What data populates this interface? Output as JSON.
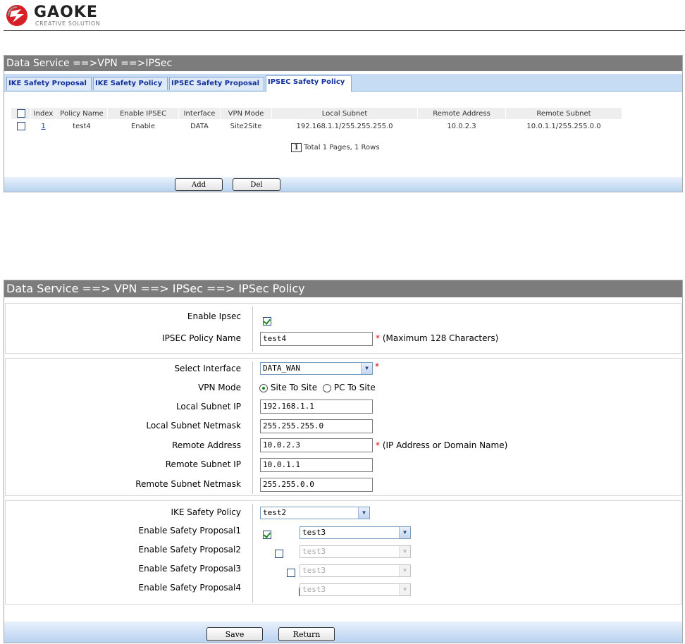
{
  "header": {
    "brand": "GAOKE",
    "tagline": "CREATIVE SOLUTION"
  },
  "list_panel": {
    "title": "Data Service ==>VPN ==>IPSec",
    "tabs": [
      {
        "label": "IKE Safety Proposal",
        "active": false
      },
      {
        "label": "IKE Safety Policy",
        "active": false
      },
      {
        "label": "IPSEC Safety Proposal",
        "active": false
      },
      {
        "label": "IPSEC Safety Policy",
        "active": true
      }
    ],
    "columns": [
      "Index",
      "Policy Name",
      "Enable IPSEC",
      "Interface",
      "VPN Mode",
      "Local Subnet",
      "Remote Address",
      "Remote Subnet"
    ],
    "rows": [
      {
        "index": "1",
        "policy_name": "test4",
        "enable_ipsec": "Enable",
        "interface": "DATA",
        "vpn_mode": "Site2Site",
        "local_subnet": "192.168.1.1/255.255.255.0",
        "remote_address": "10.0.2.3",
        "remote_subnet": "10.0.1.1/255.255.0.0"
      }
    ],
    "pager": {
      "page": "1",
      "summary": "Total 1 Pages, 1 Rows"
    },
    "add_label": "Add",
    "del_label": "Del"
  },
  "form_panel": {
    "title": "Data Service ==> VPN ==> IPSec ==> IPSec Policy",
    "enable_ipsec": {
      "label": "Enable Ipsec",
      "checked": true
    },
    "policy_name": {
      "label": "IPSEC Policy Name",
      "value": "test4",
      "note": "(Maximum 128 Characters)"
    },
    "interface": {
      "label": "Select Interface",
      "value": "DATA_WAN"
    },
    "vpn_mode": {
      "label": "VPN Mode",
      "options": [
        "Site To Site",
        "PC To Site"
      ],
      "selected": "Site To Site"
    },
    "local_subnet_ip": {
      "label": "Local Subnet IP",
      "value": "192.168.1.1"
    },
    "local_subnet_netmask": {
      "label": "Local Subnet Netmask",
      "value": "255.255.255.0"
    },
    "remote_address": {
      "label": "Remote Address",
      "value": "10.0.2.3",
      "note": "(IP Address or Domain Name)"
    },
    "remote_subnet_ip": {
      "label": "Remote Subnet IP",
      "value": "10.0.1.1"
    },
    "remote_subnet_netmask": {
      "label": "Remote Subnet Netmask",
      "value": "255.255.0.0"
    },
    "ike_policy": {
      "label": "IKE Safety Policy",
      "value": "test2"
    },
    "proposals": [
      {
        "label": "Enable Safety Proposal1",
        "checked": true,
        "value": "test3",
        "enabled": true
      },
      {
        "label": "Enable Safety Proposal2",
        "checked": false,
        "value": "test3",
        "enabled": false
      },
      {
        "label": "Enable Safety Proposal3",
        "checked": false,
        "value": "test3",
        "enabled": false
      },
      {
        "label": "Enable Safety Proposal4",
        "checked": false,
        "value": "test3",
        "enabled": false
      }
    ],
    "required_mark": "*",
    "save_label": "Save",
    "return_label": "Return"
  },
  "colors": {
    "titlebar": "#7c7c7c",
    "tabbar": "#c5dcf4",
    "tab_text": "#13319c",
    "required": "#e00000"
  }
}
